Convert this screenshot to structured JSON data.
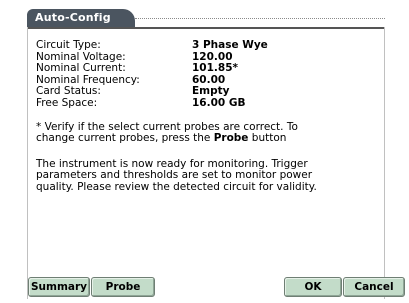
{
  "tab": {
    "title": "Auto-Config"
  },
  "fields": [
    {
      "label": "Circuit Type:",
      "value": "3 Phase Wye"
    },
    {
      "label": "Nominal Voltage:",
      "value": "120.00"
    },
    {
      "label": "Nominal Current:",
      "value": "101.85*"
    },
    {
      "label": "Nominal Frequency:",
      "value": "60.00"
    },
    {
      "label": "Card Status:",
      "value": "Empty"
    },
    {
      "label": "Free Space:",
      "value": "16.00 GB"
    }
  ],
  "note": {
    "before": "* Verify if the select current probes are correct. To\nchange current probes, press the ",
    "bold": "Probe",
    "after": " button"
  },
  "message": "The instrument is now ready for monitoring. Trigger\nparameters and thresholds are set to monitor power\nquality. Please review the detected circuit for validity.",
  "buttons": {
    "summary": "Summary",
    "probe": "Probe",
    "ok": "OK",
    "cancel": "Cancel"
  },
  "colors": {
    "tab_background": "#4b5560",
    "button_background": "#c3dcc9"
  }
}
